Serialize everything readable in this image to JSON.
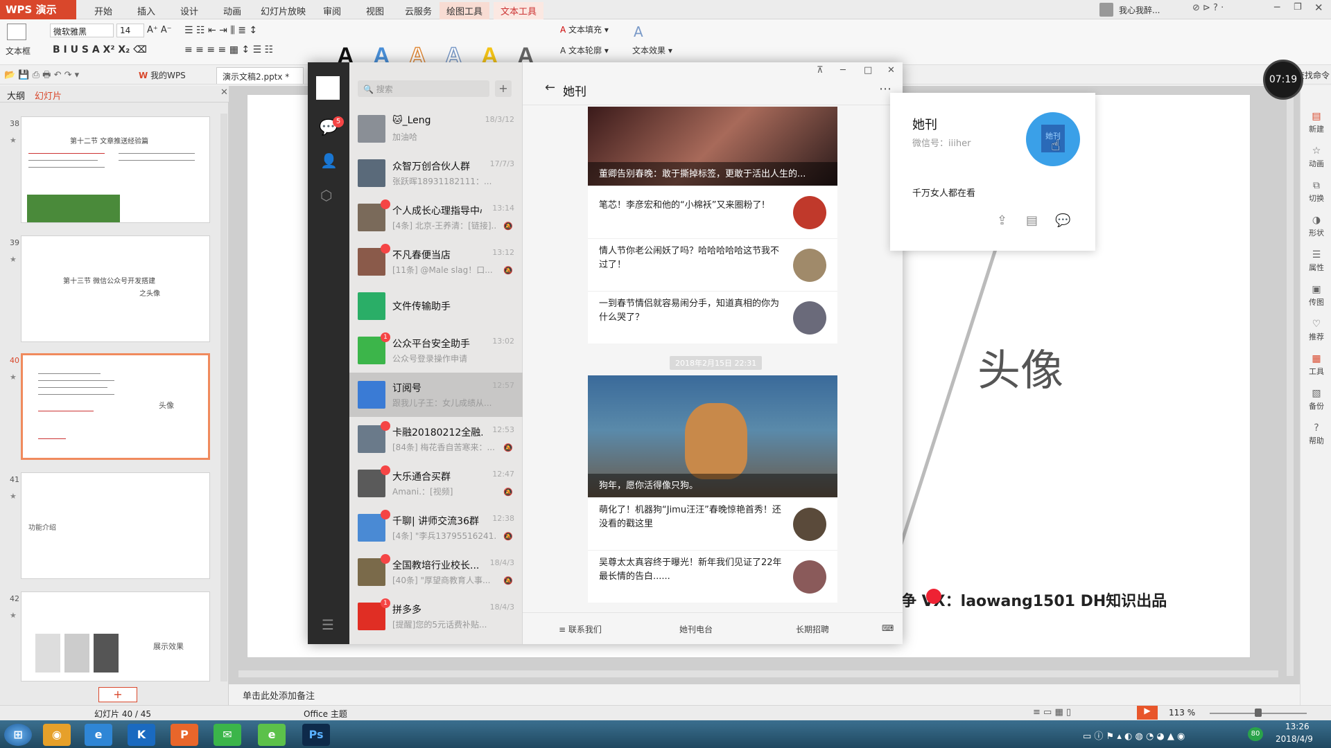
{
  "wps": {
    "logo": "WPS 演示",
    "menus": [
      "开始",
      "插入",
      "设计",
      "动画",
      "幻灯片放映",
      "审阅",
      "视图",
      "云服务"
    ],
    "tool_tabs": [
      "绘图工具",
      "文本工具"
    ],
    "user": "我心我醉...",
    "font_name": "微软雅黑",
    "font_size": "14",
    "textbox_label": "文本框",
    "text_fill": "文本填充",
    "text_outline": "文本轮廓",
    "text_effect": "文本效果",
    "style_letter": "A",
    "quick_mywps": "我的WPS",
    "doc_tab": "演示文稿2.pptx *",
    "find_cmd": "查找命令"
  },
  "left_panel": {
    "tab_outline": "大纲",
    "tab_slides": "幻灯片",
    "slides": [
      {
        "num": "38",
        "title": "第十二节 文章推送经验篇"
      },
      {
        "num": "39",
        "title": "第十三节 微信公众号开发搭建",
        "subtitle": "之头像"
      },
      {
        "num": "40",
        "side": "头像"
      },
      {
        "num": "41",
        "left": "功能介绍"
      },
      {
        "num": "42",
        "side": "展示效果"
      }
    ],
    "add_button": "+"
  },
  "slide": {
    "title": "头像",
    "footer": "争  VX：laowang1501   DH知识出品",
    "notes_placeholder": "单击此处添加备注"
  },
  "right_sidebar": [
    "新建",
    "动画",
    "切换",
    "形状",
    "属性",
    "传图",
    "推荐",
    "工具",
    "备份",
    "帮助"
  ],
  "status": {
    "slide_counter": "幻灯片 40 / 45",
    "theme": "Office 主题",
    "zoom": "113 %"
  },
  "clock": "07:19",
  "taskbar": {
    "time": "13:26",
    "date": "2018/4/9",
    "battery": "80"
  },
  "wechat": {
    "search_placeholder": "搜索",
    "nav_badge": "5",
    "chats": [
      {
        "name": "🐱_Leng",
        "preview": "加油哈",
        "time": "18/3/12",
        "color": "#8a8f96"
      },
      {
        "name": "众智万创合伙人群",
        "preview": "张跃晖18931182111：...",
        "time": "17/7/3",
        "color": "#5a6a7a"
      },
      {
        "name": "个人成长心理指导中心",
        "preview": "[4条] 北京-王养清：[链接]...",
        "time": "13:14",
        "color": "#7a6a5a",
        "badge": "•"
      },
      {
        "name": "不凡春便当店",
        "preview": "[11条] @Male slag！口...",
        "time": "13:12",
        "color": "#8a5a4a",
        "badge": "•"
      },
      {
        "name": "文件传输助手",
        "preview": "",
        "time": "",
        "color": "#2aae67"
      },
      {
        "name": "公众平台安全助手",
        "preview": "公众号登录操作申请",
        "time": "13:02",
        "color": "#3cb54a",
        "badge": "1"
      },
      {
        "name": "订阅号",
        "preview": "跟我儿子王：女儿成绩从...",
        "time": "12:57",
        "color": "#3a7bd5"
      },
      {
        "name": "卡融20180212全融...",
        "preview": "[84条] 梅花香自苦寒来：...",
        "time": "12:53",
        "color": "#6a7a8a",
        "badge": "•"
      },
      {
        "name": "大乐通合买群",
        "preview": "Amani.：[视频]",
        "time": "12:47",
        "color": "#5a5a5a",
        "badge": "•"
      },
      {
        "name": "千聊| 讲师交流36群",
        "preview": "[4条] \"李兵13795516241...",
        "time": "12:38",
        "color": "#4a8ad4",
        "badge": "•"
      },
      {
        "name": "全国教培行业校长...",
        "preview": "[40条] \"厚望商教育人事...",
        "time": "18/4/3",
        "color": "#7a6a4a",
        "badge": "•"
      },
      {
        "name": "拼多多",
        "preview": "[提醒]您的5元话费补贴...",
        "time": "18/4/3",
        "color": "#e02e24",
        "badge": "1"
      }
    ],
    "title": "她刊",
    "articles_top": [
      {
        "caption": "董卿告别春晚：敢于撕掉标签，更敢于活出人生的..."
      },
      {
        "title": "笔芯！李彦宏和他的“小棉袄”又来圈粉了!",
        "thumb": "#c0392b"
      },
      {
        "title": "情人节你老公闹妖了吗？哈哈哈哈哈这节我不过了！",
        "thumb": "#a08a6a"
      },
      {
        "title": "一到春节情侣就容易闹分手，知道真相的你为什么哭了？",
        "thumb": "#6a6a7a"
      }
    ],
    "timestamp": "2018年2月15日 22:31",
    "articles_bottom": [
      {
        "caption": "狗年，愿你活得像只狗。"
      },
      {
        "title": "萌化了！机器狗“Jimu汪汪”春晚惊艳首秀！还没看的戳这里",
        "thumb": "#5a4a3a"
      },
      {
        "title": "吴尊太太真容终于曝光！新年我们见证了22年最长情的告白......",
        "thumb": "#8a5a5a"
      }
    ],
    "footer": [
      "联系我们",
      "她刊电台",
      "长期招聘"
    ]
  },
  "profile": {
    "name": "她刊",
    "wechat_id": "微信号：iiiher",
    "desc": "千万女人都在看",
    "avatar_text": "她刊"
  }
}
